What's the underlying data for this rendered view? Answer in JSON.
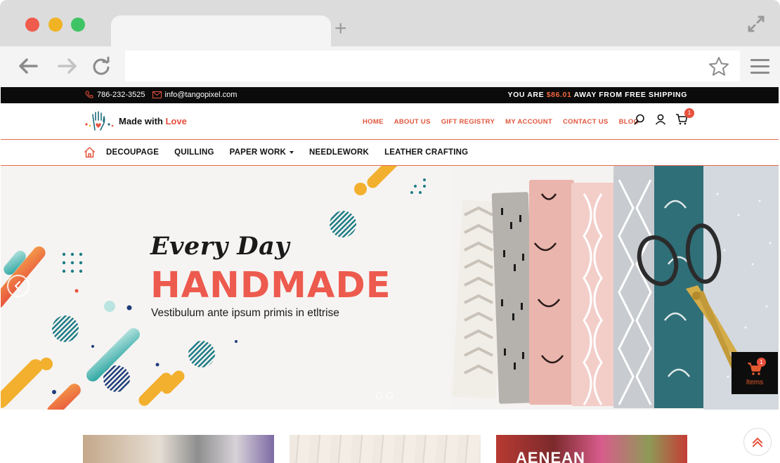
{
  "topbar": {
    "phone": "786-232-3525",
    "email": "info@tangopixel.com",
    "shipping_prefix": "YOU ARE",
    "shipping_amount": "$86.01",
    "shipping_suffix": "AWAY FROM FREE SHIPPING"
  },
  "brand": {
    "name": "Made with",
    "highlight": "Love"
  },
  "nav": {
    "links": [
      "HOME",
      "ABOUT US",
      "GIFT REGISTRY",
      "MY ACCOUNT",
      "CONTACT US",
      "BLOG"
    ],
    "cart_count": "1"
  },
  "categories": [
    "DECOUPAGE",
    "QUILLING",
    "PAPER WORK",
    "NEEDLEWORK",
    "LEATHER CRAFTING"
  ],
  "hero": {
    "script": "Every Day",
    "title": "HANDMADE",
    "subtitle": "Vestibulum ante ipsum primis in etltrise"
  },
  "cart_widget": {
    "count": "1",
    "label": "Items"
  },
  "featured": {
    "third_title": "AENEAN"
  },
  "colors": {
    "accent": "#e2553c",
    "hero_title": "#ed5a4e",
    "topbar_bg": "#0b0b0b"
  }
}
